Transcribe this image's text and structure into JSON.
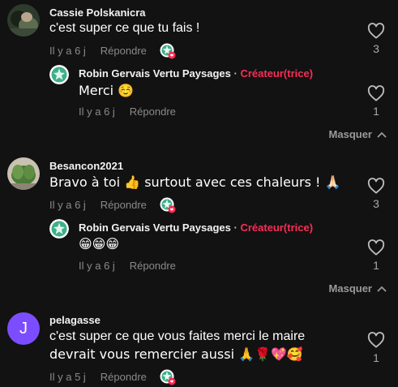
{
  "comments": [
    {
      "username": "Cassie Polskanicra",
      "text": "c'est super ce que tu fais !",
      "time": "Il y a 6 j",
      "reply_label": "Répondre",
      "likes": "3",
      "reply": {
        "username": "Robin Gervais Vertu Paysages",
        "separator": "·",
        "creator_label": "Créateur(trice)",
        "text": "Merci ☺️",
        "time": "Il y a 6 j",
        "reply_label": "Répondre",
        "likes": "1"
      },
      "hide_label": "Masquer"
    },
    {
      "username": "Besancon2021",
      "text": "Bravo à toi 👍 surtout avec ces chaleurs ! 🙏🏻",
      "time": "Il y a 6 j",
      "reply_label": "Répondre",
      "likes": "3",
      "reply": {
        "username": "Robin Gervais Vertu Paysages",
        "separator": "·",
        "creator_label": "Créateur(trice)",
        "text": "😁😁😁",
        "time": "Il y a 6 j",
        "reply_label": "Répondre",
        "likes": "1"
      },
      "hide_label": "Masquer"
    },
    {
      "username": "pelagasse",
      "avatar_letter": "J",
      "text_line1": "c'est super ce que vous faites merci le maire",
      "text_line2": "devrait vous remercier aussi 🙏🌹💖🥰",
      "time": "Il y a 5 j",
      "reply_label": "Répondre",
      "likes": "1"
    }
  ],
  "colors": {
    "background": "#121212",
    "creator": "#fe2c55",
    "meta": "#8a8a8a",
    "avatar_purple": "#7c4dff"
  },
  "icons": {
    "like": "heart-outline-icon",
    "hide": "chevron-up-icon",
    "creator_liked": "creator-liked-avatar-icon"
  }
}
